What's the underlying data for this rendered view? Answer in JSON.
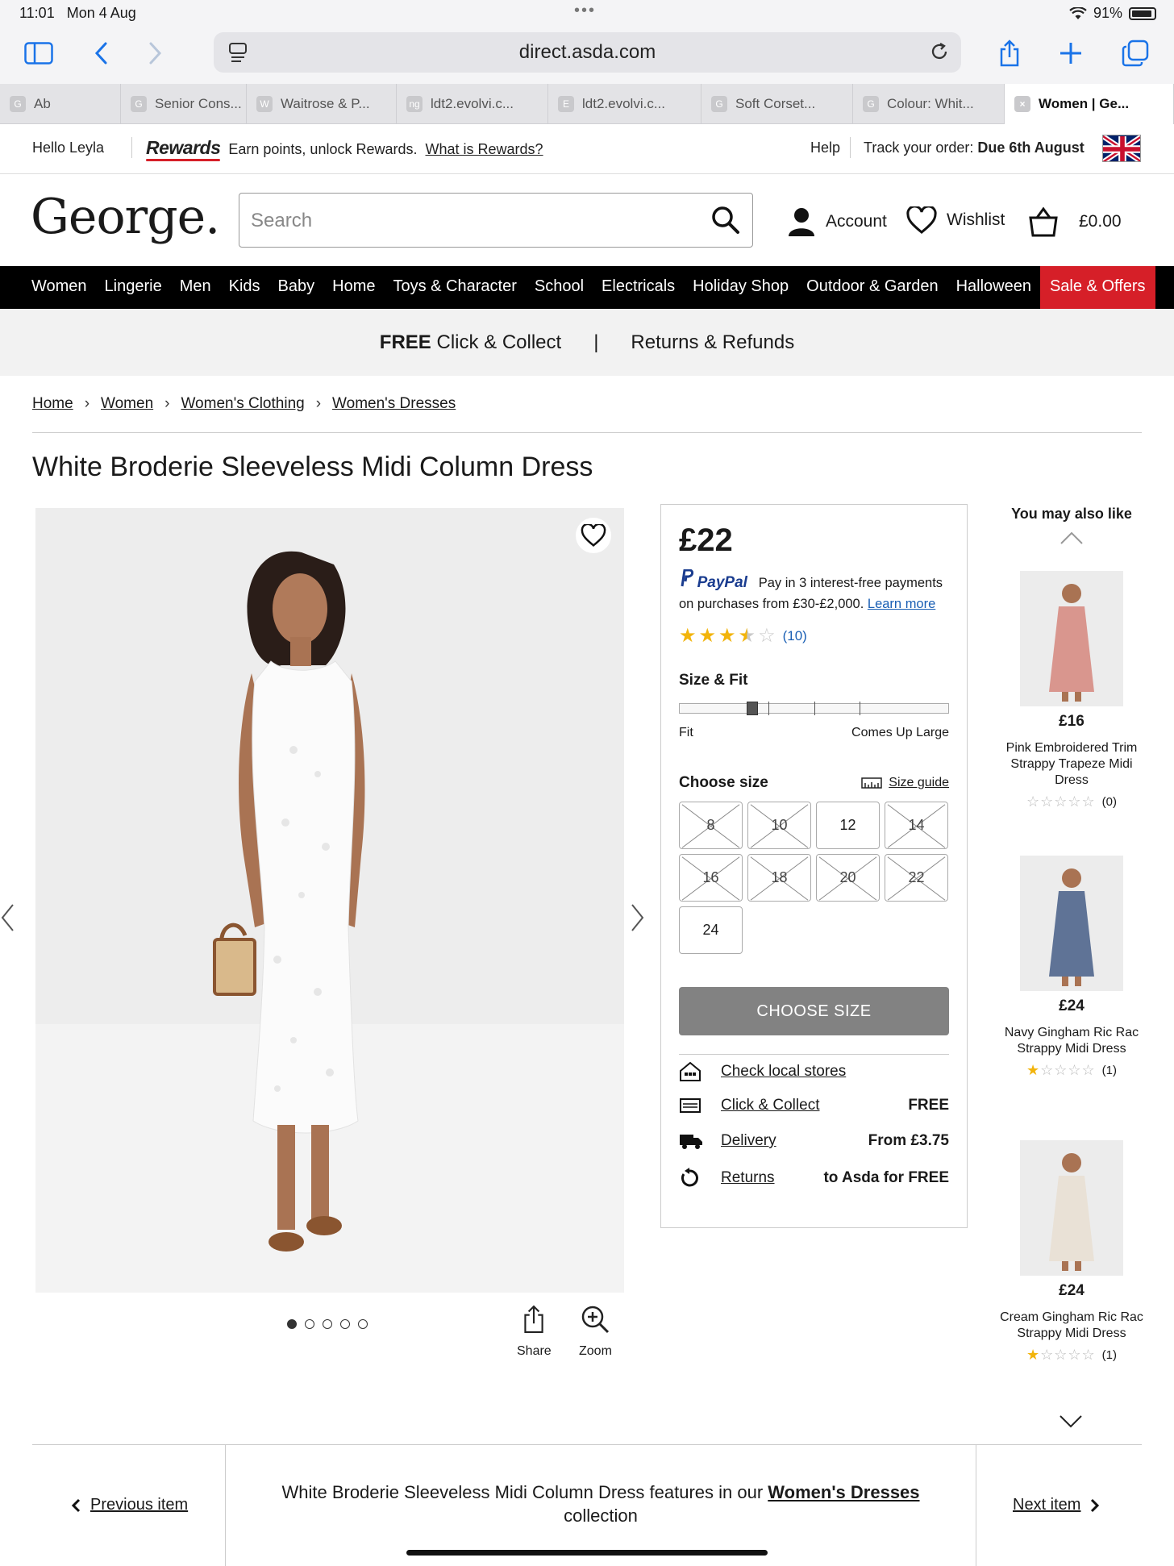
{
  "status": {
    "time": "11:01",
    "date": "Mon 4 Aug",
    "battery": "91%"
  },
  "browser": {
    "url": "direct.asda.com",
    "tabs": [
      {
        "label": "Ab",
        "fav": "G"
      },
      {
        "label": "Senior Cons...",
        "fav": "G"
      },
      {
        "label": "Waitrose & P...",
        "fav": "W"
      },
      {
        "label": "ldt2.evolvi.c...",
        "fav": "ng"
      },
      {
        "label": "ldt2.evolvi.c...",
        "fav": "E"
      },
      {
        "label": "Soft Corset...",
        "fav": "G"
      },
      {
        "label": "Colour: Whit...",
        "fav": "G"
      },
      {
        "label": "Women | Ge...",
        "fav": "×"
      }
    ]
  },
  "topstrip": {
    "hello": "Hello Leyla",
    "rewards_logo": "Rewards",
    "rewards_text": "Earn points, unlock Rewards.",
    "rewards_link": "What is Rewards?",
    "help": "Help",
    "track_label": "Track your order:",
    "track_value": "Due 6th August"
  },
  "header": {
    "logo": "George.",
    "search_placeholder": "Search",
    "account": "Account",
    "wishlist": "Wishlist",
    "basket": "£0.00"
  },
  "nav": [
    "Women",
    "Lingerie",
    "Men",
    "Kids",
    "Baby",
    "Home",
    "Toys & Character",
    "School",
    "Electricals",
    "Holiday Shop",
    "Outdoor & Garden",
    "Halloween"
  ],
  "nav_sale": "Sale & Offers",
  "promo": {
    "free": "FREE",
    "click_collect": "Click & Collect",
    "sep": "|",
    "returns": "Returns & Refunds"
  },
  "breadcrumbs": [
    "Home",
    "Women",
    "Women's Clothing",
    "Women's Dresses"
  ],
  "product": {
    "title": "White Broderie Sleeveless Midi Column Dress",
    "price": "£22",
    "paypal_logo": "PayPal",
    "paypal_text1": "Pay in 3 interest-free payments",
    "paypal_text2": "on purchases from £30-£2,000.",
    "paypal_link": "Learn more",
    "rating": 3.5,
    "reviews": "(10)",
    "size_fit_label": "Size & Fit",
    "fit_position": 0.25,
    "fit_left": "Fit",
    "fit_right": "Comes Up Large",
    "choose_size_label": "Choose size",
    "size_guide": "Size guide",
    "sizes": [
      {
        "label": "8",
        "available": false
      },
      {
        "label": "10",
        "available": false
      },
      {
        "label": "12",
        "available": true
      },
      {
        "label": "14",
        "available": false
      },
      {
        "label": "16",
        "available": false
      },
      {
        "label": "18",
        "available": false
      },
      {
        "label": "20",
        "available": false
      },
      {
        "label": "22",
        "available": false
      },
      {
        "label": "24",
        "available": true
      }
    ],
    "cta": "CHOOSE SIZE",
    "services": [
      {
        "label": "Check local stores",
        "value": "",
        "icon": "store-icon"
      },
      {
        "label": "Click & Collect",
        "value": "FREE",
        "icon": "click-collect-icon"
      },
      {
        "label": "Delivery",
        "value": "From £3.75",
        "icon": "truck-icon"
      },
      {
        "label": "Returns",
        "value": "to Asda for FREE",
        "icon": "returns-icon"
      }
    ],
    "share": "Share",
    "zoom": "Zoom",
    "image_count": 5,
    "image_index": 1
  },
  "recommendations": {
    "title": "You may also like",
    "items": [
      {
        "price": "£16",
        "name": "Pink Embroidered Trim Strappy Trapeze Midi Dress",
        "stars": 0,
        "count": "(0)",
        "color": "#d9968e"
      },
      {
        "price": "£24",
        "name": "Navy Gingham Ric Rac Strappy Midi Dress",
        "stars": 1,
        "count": "(1)",
        "color": "#5f7396"
      },
      {
        "price": "£24",
        "name": "Cream Gingham Ric Rac Strappy Midi Dress",
        "stars": 1,
        "count": "(1)",
        "color": "#e9e1d6"
      }
    ]
  },
  "bottom": {
    "prev": "Previous item",
    "next": "Next item",
    "text_before": "White Broderie Sleeveless Midi Column Dress features in our",
    "link": "Women's Dresses",
    "text_after": "collection"
  }
}
